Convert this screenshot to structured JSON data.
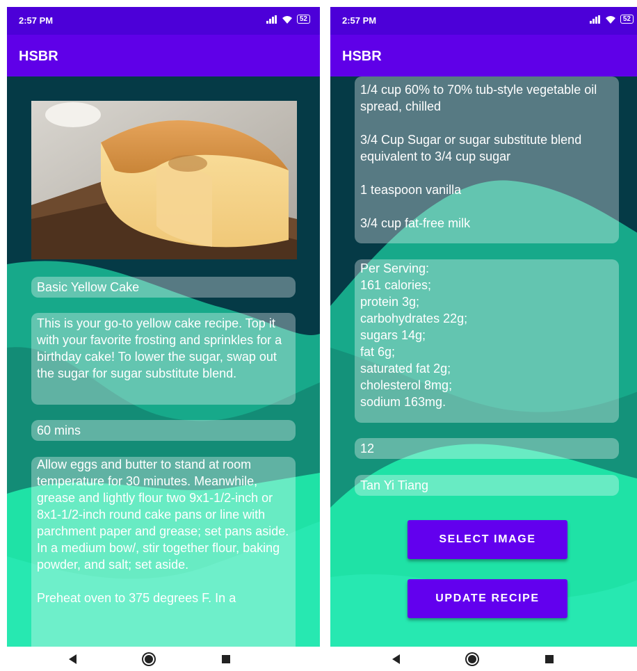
{
  "status_bar": {
    "time": "2:57 PM",
    "battery": "52"
  },
  "app": {
    "title": "HSBR"
  },
  "left_screen": {
    "recipe_image_alt": "Sponge cake with a slice removed on a wooden board",
    "recipe_name": "Basic Yellow Cake",
    "description": "This is your go-to yellow cake recipe. Top it with your favorite frosting and sprinkles for a birthday cake! To lower the sugar, swap out the sugar for sugar substitute blend.",
    "duration": "60 mins",
    "instructions": "Allow eggs and butter to stand at room temperature for 30 minutes. Meanwhile, grease and lightly flour two 9x1-1/2-inch or 8x1-1/2-inch round cake pans or line with parchment paper and grease; set pans aside. In a medium bow/, stir together flour, baking powder, and salt; set aside.\n\nPreheat oven to 375 degrees F. In a"
  },
  "right_screen": {
    "ingredients": "1/4 cup 60% to 70% tub-style vegetable oil spread, chilled\n\n3/4 Cup Sugar or sugar substitute blend equivalent to 3/4 cup sugar\n\n1 teaspoon vanilla\n\n3/4 cup fat-free milk",
    "nutrition": "Per Serving:\n161 calories;\nprotein 3g;\ncarbohydrates 22g;\nsugars 14g;\nfat 6g;\nsaturated fat 2g;\ncholesterol 8mg;\nsodium 163mg.",
    "servings": "12",
    "author": "Tan Yi Tiang",
    "select_image_label": "SELECT IMAGE",
    "update_recipe_label": "UPDATE RECIPE"
  },
  "colors": {
    "status_bar": "#4c00d8",
    "app_bar": "#5f00e8",
    "button": "#6200ee",
    "bg_dark": "#053a46",
    "bg_teal": "#17a98a",
    "bg_green": "#1fe2a6"
  }
}
